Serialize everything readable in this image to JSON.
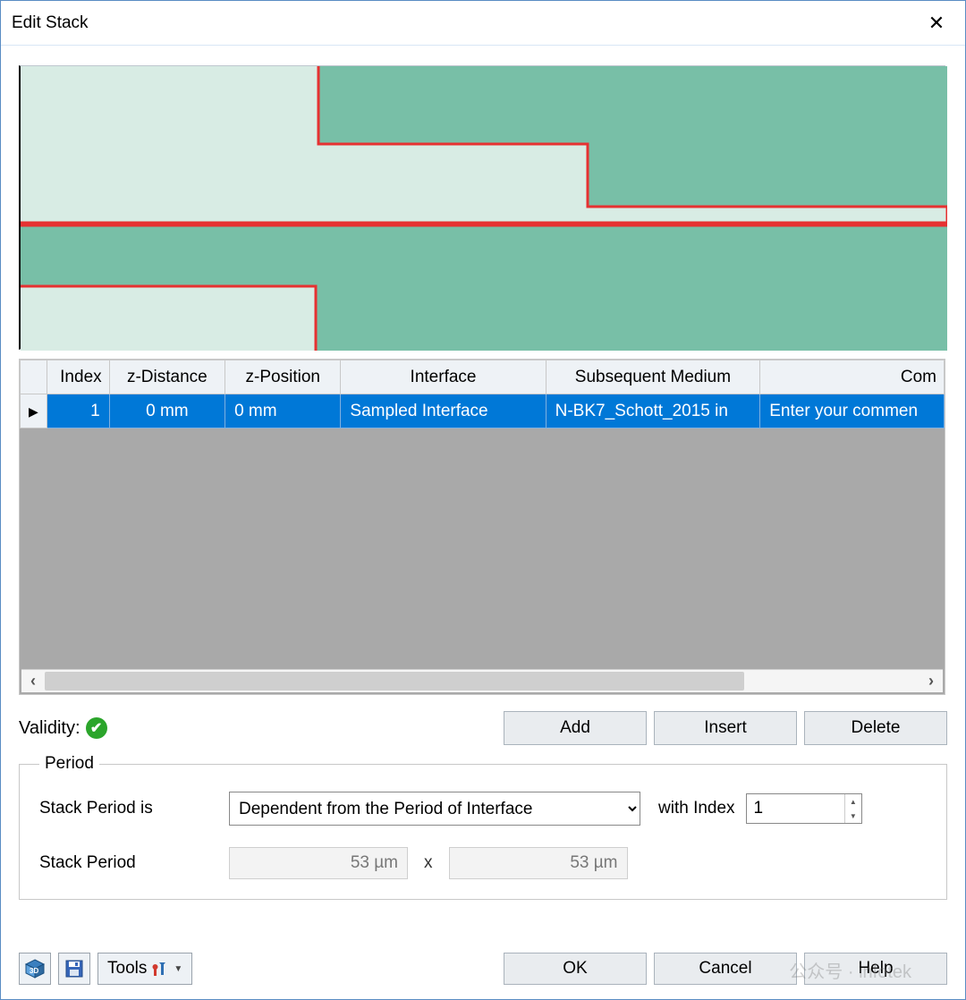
{
  "window": {
    "title": "Edit Stack"
  },
  "table": {
    "headers": {
      "index": "Index",
      "z_distance": "z-Distance",
      "z_position": "z-Position",
      "interface": "Interface",
      "subsequent_medium": "Subsequent Medium",
      "comment": "Com"
    },
    "row": {
      "index": "1",
      "z_distance": "0 mm",
      "z_position": "0 mm",
      "interface": "Sampled Interface",
      "subsequent_medium": "N-BK7_Schott_2015 in",
      "comment": "Enter your commen"
    }
  },
  "validity": {
    "label": "Validity:"
  },
  "buttons": {
    "add": "Add",
    "insert": "Insert",
    "delete": "Delete",
    "ok": "OK",
    "cancel": "Cancel",
    "help": "Help",
    "tools": "Tools"
  },
  "period": {
    "legend": "Period",
    "stack_period_is_label": "Stack Period is",
    "mode_selected": "Dependent from the Period of Interface",
    "with_index_label": "with Index",
    "with_index_value": "1",
    "stack_period_label": "Stack Period",
    "stack_period_x": "53 µm",
    "stack_period_y": "53 µm",
    "times": "x"
  },
  "watermark": "公众号 · infotek"
}
